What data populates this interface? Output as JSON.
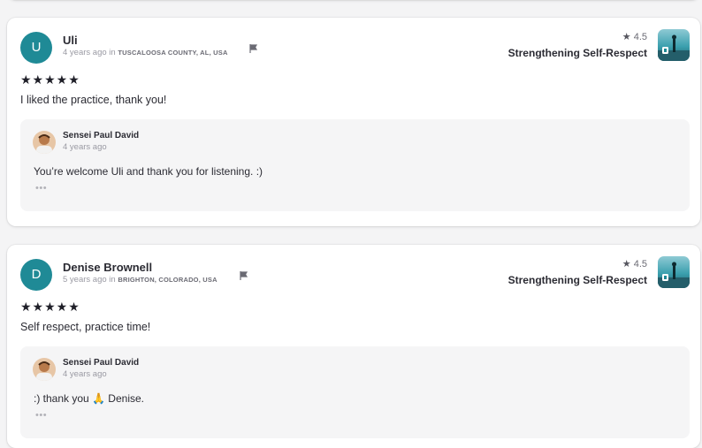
{
  "reviews": [
    {
      "avatar_initial": "U",
      "name": "Uli",
      "time_ago": "4 years ago",
      "in_word": "in",
      "location": "TUSCALOOSA COUNTY, AL, USA",
      "course_rating": "4.5",
      "course_title": "Strengthening Self-Respect",
      "stars": "★★★★★",
      "text": "I liked the practice, thank you!",
      "reply": {
        "author": "Sensei Paul David",
        "time_ago": "4 years ago",
        "text": "You’re welcome Uli and thank you for listening. :)",
        "more": "•••"
      }
    },
    {
      "avatar_initial": "D",
      "name": "Denise Brownell",
      "time_ago": "5 years ago",
      "in_word": "in",
      "location": "BRIGHTON, COLORADO, USA",
      "course_rating": "4.5",
      "course_title": "Strengthening Self-Respect",
      "stars": "★★★★★",
      "text": "Self respect, practice time!",
      "reply": {
        "author": "Sensei Paul David",
        "time_ago": "4 years ago",
        "text": ":) thank you 🙏 Denise.",
        "more": "•••"
      }
    }
  ],
  "icons": {
    "rating_star": "star-icon",
    "flag": "flag-icon",
    "course_thumbnail": "course-thumbnail-image"
  },
  "colors": {
    "avatar_bg": "#1f8a96",
    "card_bg": "#ffffff",
    "reply_bg": "#f5f5f6",
    "page_bg": "#f4f4f5"
  }
}
